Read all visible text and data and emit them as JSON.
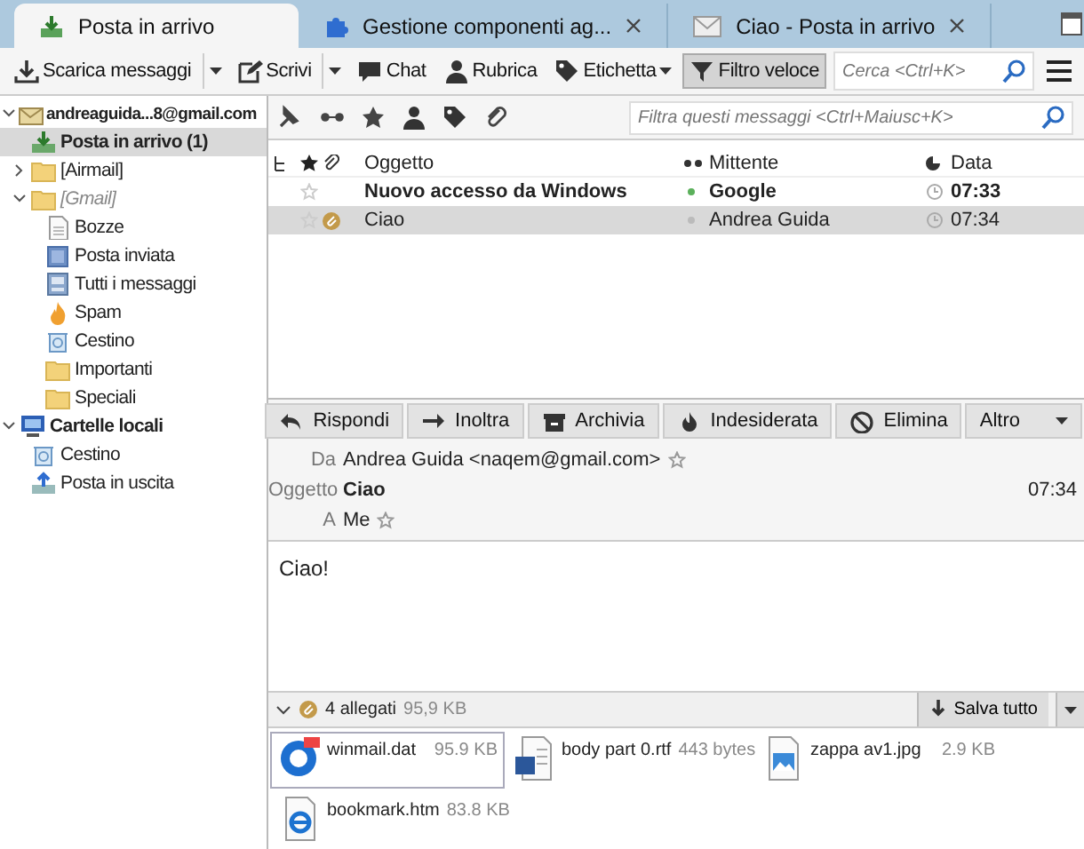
{
  "tabs": [
    {
      "label": "Posta in arrivo",
      "selected": true,
      "closable": false
    },
    {
      "label": "Gestione componenti ag...",
      "selected": false,
      "closable": true
    },
    {
      "label": "Ciao - Posta in arrivo",
      "selected": false,
      "closable": true
    }
  ],
  "toolbar": {
    "buttons": [
      {
        "label": "Scarica messaggi",
        "kind": "split",
        "pressed": false
      },
      {
        "label": "Scrivi",
        "kind": "split",
        "pressed": false
      },
      {
        "label": "Chat",
        "kind": "plain",
        "pressed": false
      },
      {
        "label": "Rubrica",
        "kind": "plain",
        "pressed": false
      },
      {
        "label": "Etichetta",
        "kind": "menu",
        "pressed": false
      },
      {
        "label": "Filtro veloce",
        "kind": "plain",
        "pressed": true
      }
    ],
    "search": {
      "placeholder": "Cerca <Ctrl+K>"
    }
  },
  "sidebar": {
    "items": [
      {
        "label": "andreaguida...8@gmail.com",
        "kind": "account",
        "selected": false,
        "expanded": true,
        "children": [
          {
            "label": "Posta in arrivo (1)",
            "kind": "inbox",
            "selected": true
          },
          {
            "label": "[Airmail]",
            "kind": "folder",
            "selected": false,
            "expanded": false
          },
          {
            "label": "[Gmail]",
            "kind": "group",
            "selected": false,
            "expanded": true,
            "children": [
              {
                "label": "Bozze",
                "kind": "drafts",
                "selected": false
              },
              {
                "label": "Posta inviata",
                "kind": "sent",
                "selected": false
              },
              {
                "label": "Tutti i messaggi",
                "kind": "archive",
                "selected": false
              },
              {
                "label": "Spam",
                "kind": "spam",
                "selected": false
              },
              {
                "label": "Cestino",
                "kind": "trash",
                "selected": false
              },
              {
                "label": "Importanti",
                "kind": "folder",
                "selected": false
              },
              {
                "label": "Speciali",
                "kind": "folder",
                "selected": false
              }
            ]
          }
        ]
      },
      {
        "label": "Cartelle locali",
        "kind": "local",
        "selected": false,
        "expanded": true,
        "children": [
          {
            "label": "Cestino",
            "kind": "trash",
            "selected": false
          },
          {
            "label": "Posta in uscita",
            "kind": "outbox",
            "selected": false
          }
        ]
      }
    ]
  },
  "filter": {
    "placeholder": "Filtra questi messaggi <Ctrl+Maiusc+K>"
  },
  "columns": {
    "subject": "Oggetto",
    "sender": "Mittente",
    "date": "Data"
  },
  "messages": [
    {
      "subject": "Nuovo accesso da Windows",
      "sender": "Google",
      "date": "07:33",
      "unread": true,
      "selected": false,
      "starred": false,
      "attachment": false
    },
    {
      "subject": "Ciao",
      "sender": "Andrea Guida",
      "date": "07:34",
      "unread": false,
      "selected": true,
      "starred": false,
      "attachment": true
    }
  ],
  "message": {
    "actions": [
      {
        "label": "Rispondi",
        "kind": "reply"
      },
      {
        "label": "Inoltra",
        "kind": "forward"
      },
      {
        "label": "Archivia",
        "kind": "archive"
      },
      {
        "label": "Indesiderata",
        "kind": "junk"
      },
      {
        "label": "Elimina",
        "kind": "delete"
      },
      {
        "label": "Altro",
        "kind": "more"
      }
    ],
    "from_label": "Da",
    "from": "Andrea Guida <naqem@gmail.com>",
    "subject_label": "Oggetto",
    "subject": "Ciao",
    "date": "07:34",
    "to_label": "A",
    "to": "Me",
    "body": "Ciao!"
  },
  "attachments": {
    "expanded": true,
    "count": "4 allegati",
    "size": "95,9 KB",
    "save": "Salva tutto",
    "items": [
      {
        "name": "winmail.dat",
        "size": "95.9 KB",
        "kind": "dat",
        "selected": true
      },
      {
        "name": "body part 0.rtf",
        "size": "443 bytes",
        "kind": "doc",
        "selected": false
      },
      {
        "name": "zappa av1.jpg",
        "size": "2.9 KB",
        "kind": "image",
        "selected": false
      },
      {
        "name": "bookmark.htm",
        "size": "83.8 KB",
        "kind": "web",
        "selected": false
      }
    ]
  }
}
